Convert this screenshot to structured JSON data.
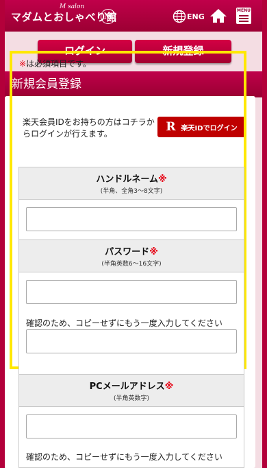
{
  "header": {
    "logo_text": "マダムとおしゃべり館",
    "logo_subscript": "M salon",
    "emblem_letter": "M",
    "language_label": "ENG",
    "menu_label": "MENU"
  },
  "auth": {
    "login_label": "ログイン",
    "register_label": "新規登録"
  },
  "section": {
    "title": "新規会員登録"
  },
  "rakuten": {
    "description": "楽天会員IDをお持ちの方はコチラからログインが行えます。",
    "button_glyph": "R",
    "button_label": "楽天IDでログイン",
    "brand_color": "#bf0000"
  },
  "form": {
    "required_mark": "※",
    "required_note": "は必須項目です。",
    "fields": [
      {
        "label": "ハンドルネーム",
        "hint": "(半角、全角3〜8文字)",
        "value": ""
      },
      {
        "label": "パスワード",
        "hint": "(半角英数6〜16文字)",
        "value": "",
        "confirm_text": "確認のため、コピーせずにもう一度入力してください",
        "confirm_value": ""
      },
      {
        "label": "PCメールアドレス",
        "hint": "(半角英数字)",
        "value": "",
        "confirm_text": "確認のため、コピーせずにもう一度入力してください"
      }
    ]
  },
  "colors": {
    "brand": "#b3003a",
    "required": "#e60012",
    "highlight": "#ffe800"
  }
}
